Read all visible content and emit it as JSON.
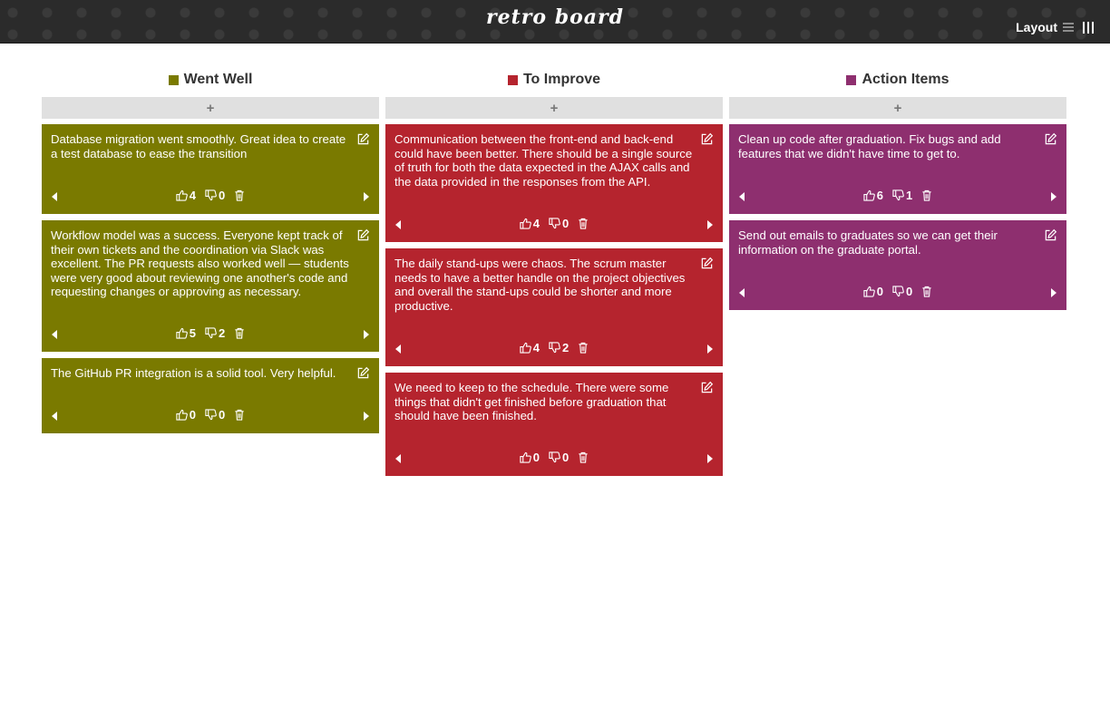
{
  "app": {
    "title": "retro board",
    "layout_label": "Layout"
  },
  "colors": {
    "went_well": "#7a7a00",
    "to_improve": "#b5242e",
    "action_items": "#8e2f6f"
  },
  "add_symbol": "+",
  "columns": [
    {
      "title": "Went Well",
      "cards": [
        {
          "text": "Database migration went smoothly. Great idea to create a test database to ease the transition",
          "likes": "4",
          "dislikes": "0"
        },
        {
          "text": "Workflow model was a success. Everyone kept track of their own tickets and the coordination via Slack was excellent. The PR requests also worked well — students were very good about reviewing one another's code and requesting changes or approving as necessary.",
          "likes": "5",
          "dislikes": "2"
        },
        {
          "text": "The GitHub PR integration is a solid tool. Very helpful.",
          "likes": "0",
          "dislikes": "0"
        }
      ]
    },
    {
      "title": "To Improve",
      "cards": [
        {
          "text": "Communication between the front-end and back-end could have been better. There should be a single source of truth for both the data expected in the AJAX calls and the data provided in the responses from the API.",
          "likes": "4",
          "dislikes": "0"
        },
        {
          "text": "The daily stand-ups were chaos. The scrum master needs to have a better handle on the project objectives and overall the stand-ups could be shorter and more productive.",
          "likes": "4",
          "dislikes": "2"
        },
        {
          "text": "We need to keep to the schedule. There were some things that didn't get finished before graduation that should have been finished.",
          "likes": "0",
          "dislikes": "0"
        }
      ]
    },
    {
      "title": "Action Items",
      "cards": [
        {
          "text": "Clean up code after graduation. Fix bugs and add features that we didn't have time to get to.",
          "likes": "6",
          "dislikes": "1"
        },
        {
          "text": "Send out emails to graduates so we can get their information on the graduate portal.",
          "likes": "0",
          "dislikes": "0"
        }
      ]
    }
  ]
}
